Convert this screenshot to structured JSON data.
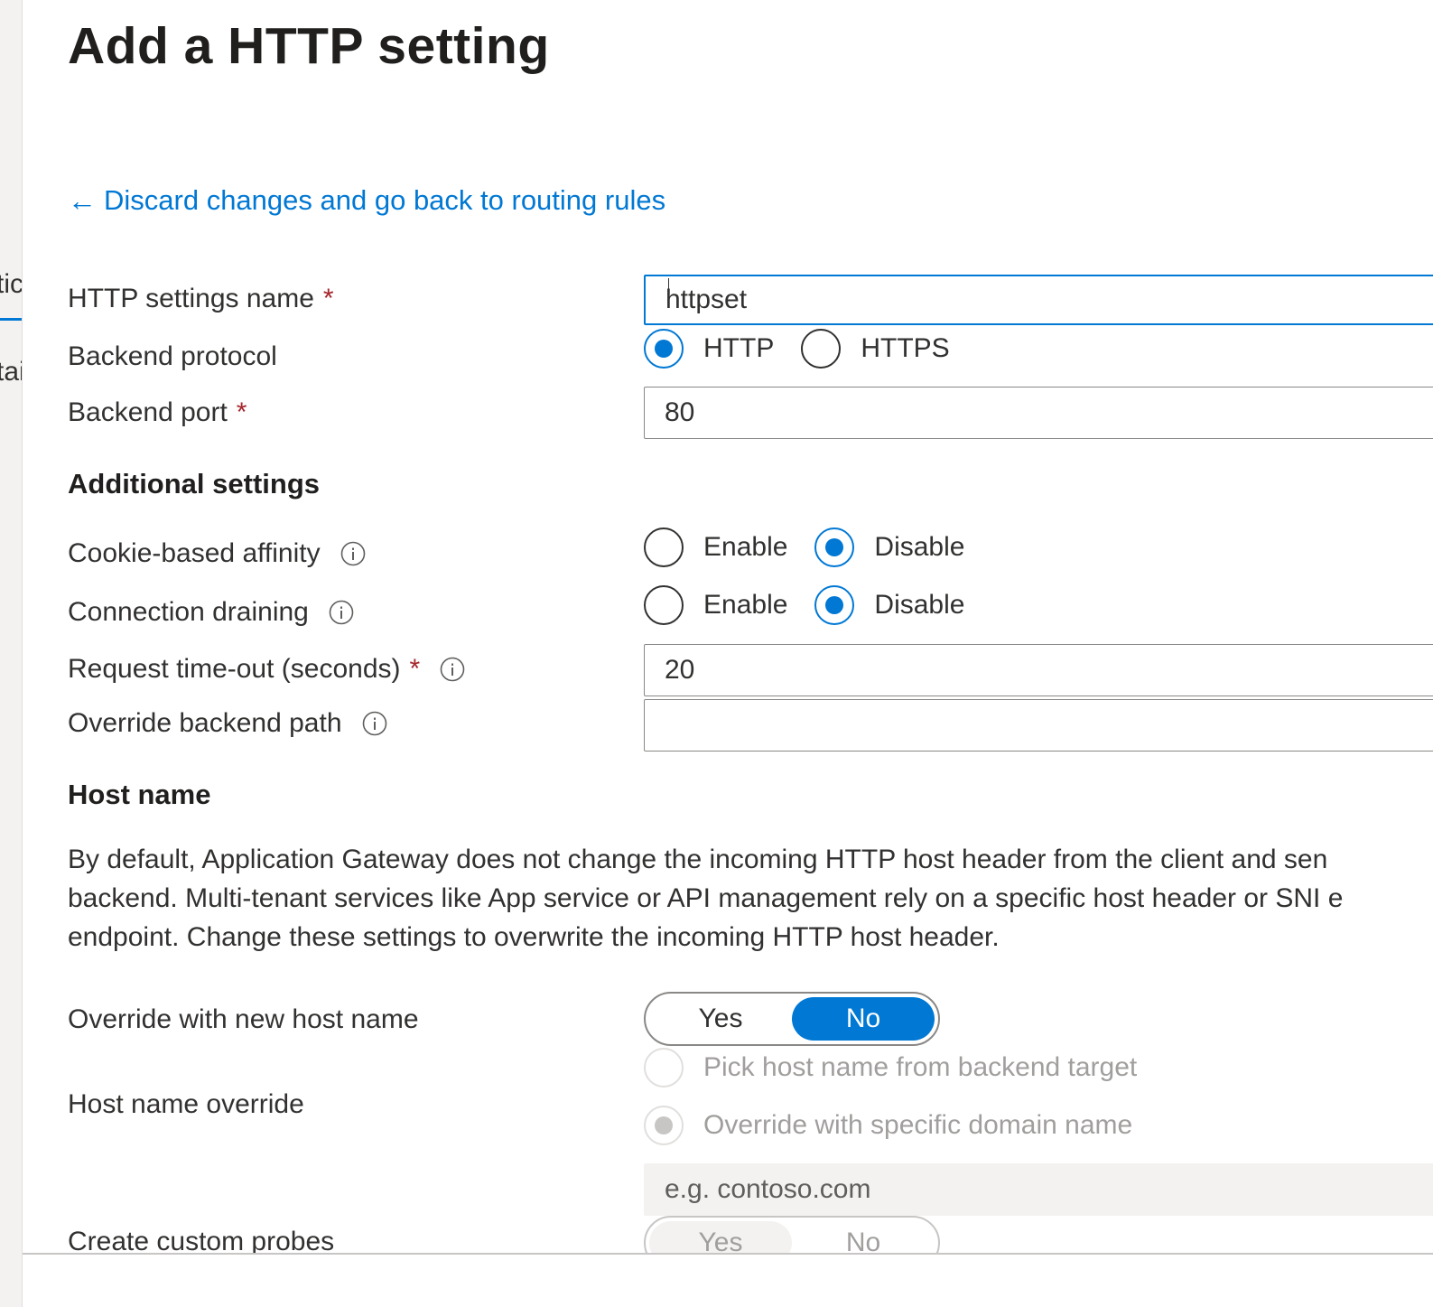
{
  "side_fragments": {
    "top": "tic",
    "bottom": "tai"
  },
  "title": "Add a HTTP setting",
  "back_link": {
    "label": "Discard changes and go back to routing rules",
    "icon": "arrow-left-icon"
  },
  "fields": {
    "http_settings_name": {
      "label": "HTTP settings name",
      "required_mark": "*",
      "value": "httpset"
    },
    "backend_protocol": {
      "label": "Backend protocol",
      "options": [
        "HTTP",
        "HTTPS"
      ],
      "selected": "HTTP"
    },
    "backend_port": {
      "label": "Backend port",
      "required_mark": "*",
      "value": "80"
    }
  },
  "additional_settings": {
    "heading": "Additional settings",
    "cookie_affinity": {
      "label": "Cookie-based affinity",
      "options": [
        "Enable",
        "Disable"
      ],
      "selected": "Disable"
    },
    "connection_draining": {
      "label": "Connection draining",
      "options": [
        "Enable",
        "Disable"
      ],
      "selected": "Disable"
    },
    "request_timeout": {
      "label": "Request time-out (seconds)",
      "required_mark": "*",
      "value": "20"
    },
    "override_backend_path": {
      "label": "Override backend path",
      "value": ""
    }
  },
  "host_name": {
    "heading": "Host name",
    "description_lines": [
      "By default, Application Gateway does not change the incoming HTTP host header from the client and sen",
      "backend. Multi-tenant services like App service or API management rely on a specific host header or SNI e",
      "endpoint. Change these settings to overwrite the incoming HTTP host header."
    ],
    "override_new_host": {
      "label": "Override with new host name",
      "options": [
        "Yes",
        "No"
      ],
      "selected": "No"
    },
    "host_name_override": {
      "label": "Host name override",
      "options": [
        "Pick host name from backend target",
        "Override with specific domain name"
      ],
      "selected": "Override with specific domain name",
      "placeholder": "e.g. contoso.com"
    },
    "create_custom_probes": {
      "label": "Create custom probes",
      "options": [
        "Yes",
        "No"
      ],
      "selected": "Yes"
    }
  },
  "colors": {
    "accent": "#0078d4",
    "required": "#a4262c",
    "text": "#323130",
    "disabled_text": "#a19f9d"
  }
}
